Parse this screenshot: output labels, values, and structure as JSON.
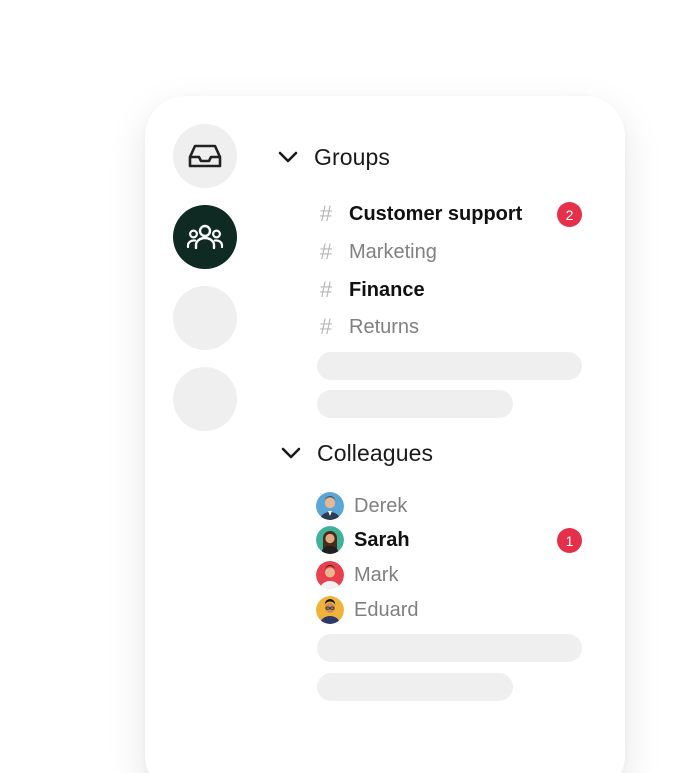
{
  "rail": {
    "items": [
      {
        "icon": "inbox-icon",
        "active": false
      },
      {
        "icon": "groups-icon",
        "active": true
      },
      {
        "icon": "",
        "active": false
      },
      {
        "icon": "",
        "active": false
      }
    ]
  },
  "groups": {
    "title": "Groups",
    "channels": [
      {
        "name": "Customer support",
        "unread": true,
        "badge": "2"
      },
      {
        "name": "Marketing",
        "unread": false
      },
      {
        "name": "Finance",
        "unread": true
      },
      {
        "name": "Returns",
        "unread": false
      }
    ]
  },
  "colleagues": {
    "title": "Colleagues",
    "people": [
      {
        "name": "Derek",
        "unread": false,
        "avatar_color": "#5aa6d6"
      },
      {
        "name": "Sarah",
        "unread": true,
        "badge": "1",
        "avatar_color": "#3fb39a"
      },
      {
        "name": "Mark",
        "unread": false,
        "avatar_color": "#e8404f"
      },
      {
        "name": "Eduard",
        "unread": false,
        "avatar_color": "#f0b33a"
      }
    ]
  },
  "colors": {
    "active_rail": "#0e2a22",
    "badge": "#e6304b",
    "skeleton": "#efefef"
  }
}
